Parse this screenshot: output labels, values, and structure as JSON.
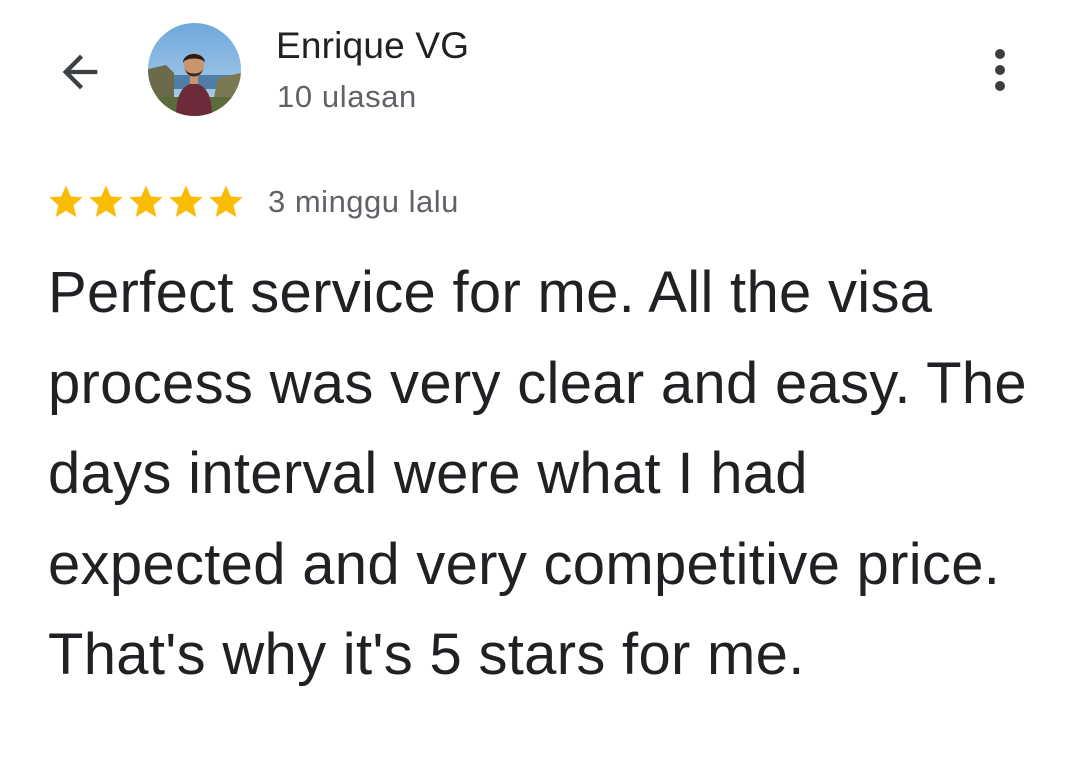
{
  "header": {
    "back_icon": "arrow-left-icon",
    "author_name": "Enrique VG",
    "review_count": "10 ulasan",
    "more_icon": "more-vertical-icon"
  },
  "review": {
    "rating": 5,
    "rating_max": 5,
    "star_color": "#FBBC04",
    "time_ago": "3 minggu lalu",
    "text": "Perfect service for me. All the visa process was very clear and easy. The days interval were what I had expected and very competitive price. That's why it's 5 stars for me."
  }
}
